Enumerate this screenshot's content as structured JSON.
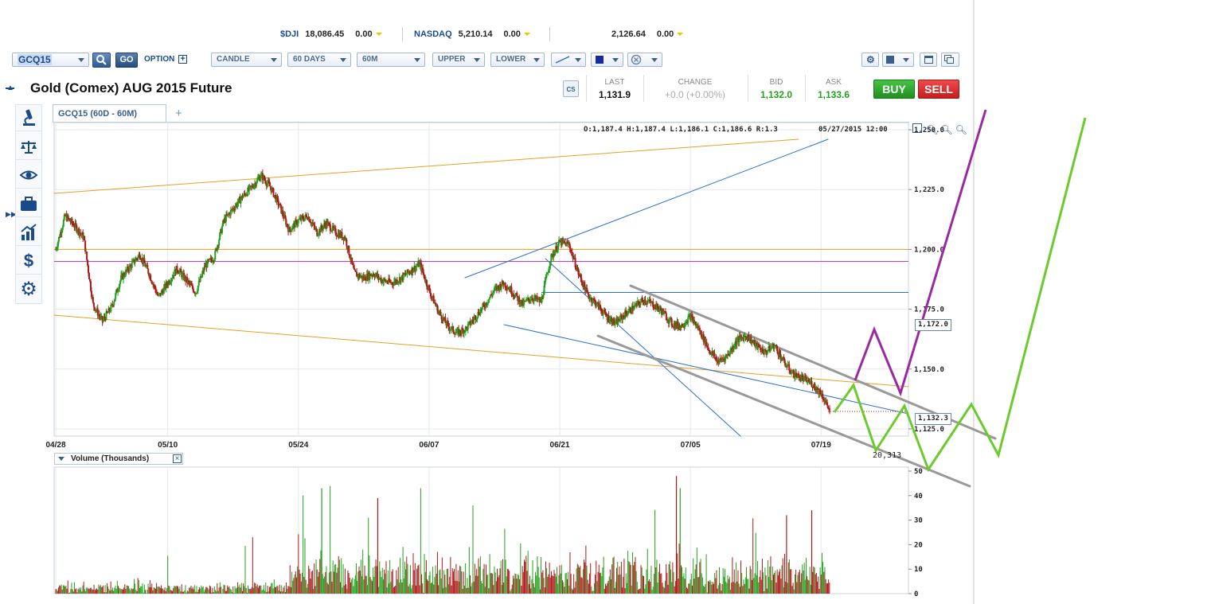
{
  "tickers": [
    {
      "name": "$DJI",
      "value": "18,086.45",
      "change": "0.00"
    },
    {
      "name": "NASDAQ",
      "value": "5,210.14",
      "change": "0.00"
    },
    {
      "name": "",
      "value": "2,126.64",
      "change": "0.00"
    }
  ],
  "toolbar": {
    "symbol": "GCQ15",
    "go_label": "GO",
    "option_label": "OPTION",
    "chart_type": "CANDLE",
    "range": "60 DAYS",
    "interval": "60M",
    "upper": "UPPER",
    "lower": "LOWER"
  },
  "instrument": {
    "title": "Gold (Comex) AUG 2015 Future"
  },
  "quote": {
    "last_label": "LAST",
    "last": "1,131.9",
    "change_label": "CHANGE",
    "change": "+0.0 (+0.00%)",
    "bid_label": "BID",
    "bid": "1,132.0",
    "ask_label": "ASK",
    "ask": "1,133.6",
    "buy_label": "BUY",
    "sell_label": "SELL"
  },
  "colors": {
    "up": "#22a21c",
    "down": "#b01818",
    "accent": "#1a4a8a",
    "buy": "#2aa52a",
    "sell": "#d42a2a",
    "orange_line": "#e8a020",
    "magenta_line": "#c837c8",
    "blue_line": "#2a6fd6",
    "gray_channel": "#999999",
    "green_projection": "#6ccb2c",
    "purple_projection": "#9a2aa0"
  },
  "tab": {
    "label": "GCQ15 (60D - 60M)"
  },
  "ohlc": "O:1,187.4 H:1,187.4 L:1,186.1 C:1,186.6 R:1.3",
  "timestamp": "05/27/2015 12:00",
  "volume_panel": {
    "title": "Volume (Thousands)",
    "last_value": "20,313"
  },
  "callouts": {
    "level": "1,172.0",
    "last": "1,132.3"
  },
  "chart_data": [
    {
      "type": "line",
      "subtype": "candlestick",
      "title": "Gold (Comex) AUG 2015 Future",
      "x_ticks": [
        "04/28",
        "05/10",
        "05/24",
        "06/07",
        "06/21",
        "07/05",
        "07/19"
      ],
      "x_tick_days": [
        0,
        12,
        26,
        40,
        54,
        68,
        82
      ],
      "y_ticks": [
        1250.0,
        1225.0,
        1200.0,
        1175.0,
        1150.0,
        1125.0
      ],
      "y_tick_labels": [
        "1,250.0",
        "1,225.0",
        "1,200.0",
        "1,175.0",
        "1,150.0",
        "1,125.0"
      ],
      "ylim": [
        1122,
        1253
      ],
      "grid": true,
      "series": [
        {
          "points": [
            [
              0,
              1200
            ],
            [
              1,
              1214
            ],
            [
              2,
              1210
            ],
            [
              3,
              1205
            ],
            [
              4,
              1177
            ],
            [
              5,
              1170
            ],
            [
              6,
              1176
            ],
            [
              7,
              1188
            ],
            [
              8,
              1193
            ],
            [
              9,
              1198
            ],
            [
              10,
              1190
            ],
            [
              11,
              1180
            ],
            [
              12,
              1186
            ],
            [
              13,
              1192
            ],
            [
              14,
              1187
            ],
            [
              15,
              1182
            ],
            [
              16,
              1193
            ],
            [
              17,
              1197
            ],
            [
              18,
              1212
            ],
            [
              19,
              1217
            ],
            [
              20,
              1222
            ],
            [
              21,
              1226
            ],
            [
              22,
              1231
            ],
            [
              23,
              1226
            ],
            [
              24,
              1218
            ],
            [
              25,
              1208
            ],
            [
              26,
              1212
            ],
            [
              27,
              1214
            ],
            [
              28,
              1207
            ],
            [
              29,
              1211
            ],
            [
              30,
              1207
            ],
            [
              31,
              1205
            ],
            [
              32,
              1190
            ],
            [
              33,
              1188
            ],
            [
              34,
              1190
            ],
            [
              35,
              1187
            ],
            [
              36,
              1186
            ],
            [
              37,
              1188
            ],
            [
              38,
              1191
            ],
            [
              39,
              1194
            ],
            [
              40,
              1183
            ],
            [
              41,
              1174
            ],
            [
              42,
              1168
            ],
            [
              43,
              1165
            ],
            [
              44,
              1167
            ],
            [
              45,
              1172
            ],
            [
              46,
              1177
            ],
            [
              47,
              1183
            ],
            [
              48,
              1186
            ],
            [
              49,
              1182
            ],
            [
              50,
              1177
            ],
            [
              51,
              1180
            ],
            [
              52,
              1178
            ],
            [
              53,
              1196
            ],
            [
              54,
              1203
            ],
            [
              55,
              1202
            ],
            [
              56,
              1190
            ],
            [
              57,
              1181
            ],
            [
              58,
              1177
            ],
            [
              59,
              1172
            ],
            [
              60,
              1169
            ],
            [
              61,
              1173
            ],
            [
              62,
              1176
            ],
            [
              63,
              1179
            ],
            [
              64,
              1177
            ],
            [
              65,
              1174
            ],
            [
              66,
              1169
            ],
            [
              67,
              1168
            ],
            [
              68,
              1172
            ],
            [
              69,
              1166
            ],
            [
              70,
              1158
            ],
            [
              71,
              1153
            ],
            [
              72,
              1156
            ],
            [
              73,
              1162
            ],
            [
              74,
              1164
            ],
            [
              75,
              1160
            ],
            [
              76,
              1157
            ],
            [
              77,
              1160
            ],
            [
              78,
              1153
            ],
            [
              79,
              1148
            ],
            [
              80,
              1146
            ],
            [
              81,
              1144
            ],
            [
              82,
              1140
            ],
            [
              83,
              1132
            ]
          ]
        }
      ],
      "reference_lines": [
        1200,
        1195,
        1182
      ],
      "projection_lines": [
        "green",
        "purple"
      ]
    },
    {
      "type": "bar",
      "title": "Volume (Thousands)",
      "y_ticks": [
        0,
        10,
        20,
        30,
        40,
        50
      ],
      "ylim": [
        0,
        50
      ],
      "last_value": "20,313"
    }
  ]
}
